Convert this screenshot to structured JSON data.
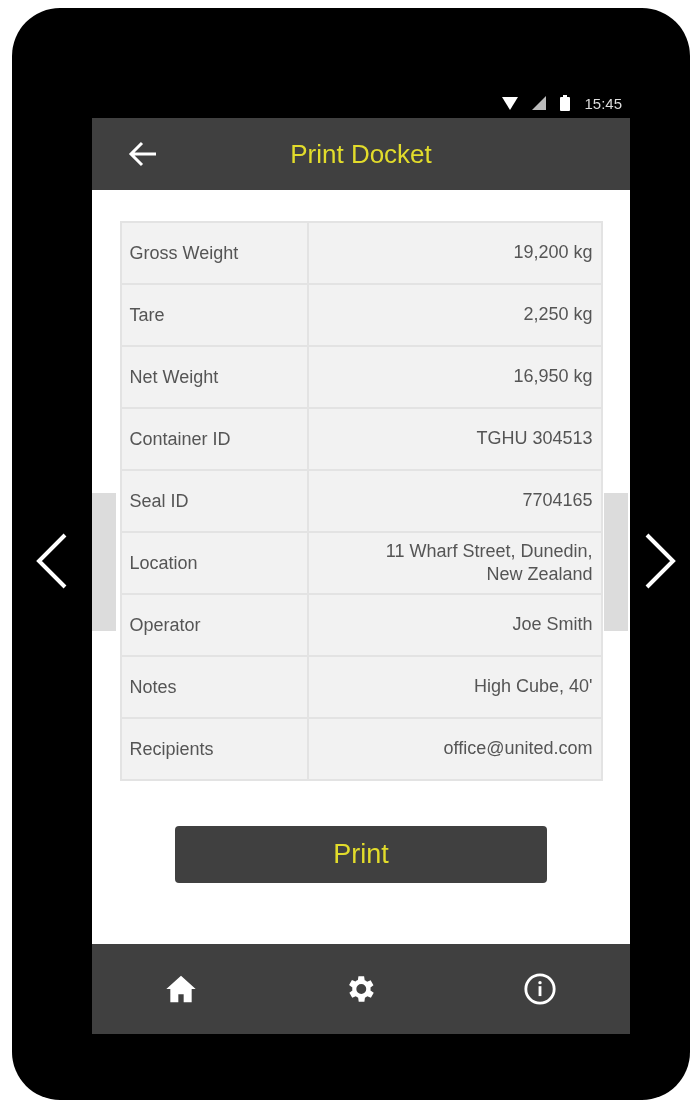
{
  "status_bar": {
    "time": "15:45"
  },
  "header": {
    "title": "Print Docket"
  },
  "rows": [
    {
      "label": "Gross Weight",
      "value": "19,200 kg"
    },
    {
      "label": "Tare",
      "value": "2,250 kg"
    },
    {
      "label": "Net Weight",
      "value": "16,950 kg"
    },
    {
      "label": "Container ID",
      "value": "TGHU 304513"
    },
    {
      "label": "Seal ID",
      "value": "7704165"
    },
    {
      "label": "Location",
      "value": "11 Wharf Street, Dunedin, New Zealand"
    },
    {
      "label": "Operator",
      "value": "Joe Smith"
    },
    {
      "label": "Notes",
      "value": "High Cube, 40'"
    },
    {
      "label": "Recipients",
      "value": "office@united.com"
    }
  ],
  "print_button": {
    "label": "Print"
  },
  "bottom_nav": [
    {
      "kind": "home"
    },
    {
      "kind": "settings"
    },
    {
      "kind": "info"
    }
  ]
}
